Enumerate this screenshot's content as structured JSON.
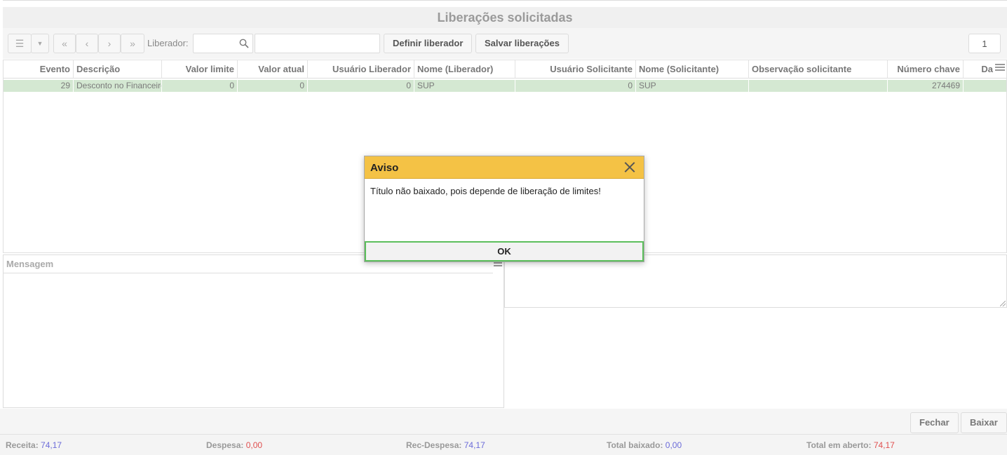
{
  "title": "Liberações solicitadas",
  "toolbar": {
    "liberador_label": "Liberador:",
    "definir_label": "Definir liberador",
    "salvar_label": "Salvar liberações",
    "page_number": "1"
  },
  "grid": {
    "columns": [
      "Evento",
      "Descrição",
      "Valor limite",
      "Valor atual",
      "Usuário Liberador",
      "Nome (Liberador)",
      "Usuário Solicitante",
      "Nome (Solicitante)",
      "Observação solicitante",
      "Número chave",
      "Da"
    ],
    "rows": [
      {
        "evento": "29",
        "descricao": "Desconto no Financeiro",
        "valor_limite": "0",
        "valor_atual": "0",
        "usuario_liberador": "0",
        "nome_liberador": "SUP",
        "usuario_solicitante": "0",
        "nome_solicitante": "SUP",
        "observacao": "",
        "numero_chave": "274469",
        "data": ""
      }
    ]
  },
  "message_panel": {
    "header": "Mensagem"
  },
  "footer": {
    "fechar_label": "Fechar",
    "baixar_label": "Baixar"
  },
  "status": {
    "receita_label": "Receita:",
    "receita_value": "74,17",
    "despesa_label": "Despesa:",
    "despesa_value": "0,00",
    "rec_despesa_label": "Rec-Despesa:",
    "rec_despesa_value": "74,17",
    "total_baixado_label": "Total baixado:",
    "total_baixado_value": "0,00",
    "total_aberto_label": "Total em aberto:",
    "total_aberto_value": "74,17"
  },
  "dialog": {
    "title": "Aviso",
    "message": "Título não baixado, pois depende de liberação de limites!",
    "ok_label": "OK"
  },
  "colors": {
    "dialog_header": "#f4c245",
    "row_highlight": "#d4e8d2",
    "ok_border": "#5cbf5c",
    "value_blue": "#6c6cd9",
    "value_red": "#e05050"
  }
}
